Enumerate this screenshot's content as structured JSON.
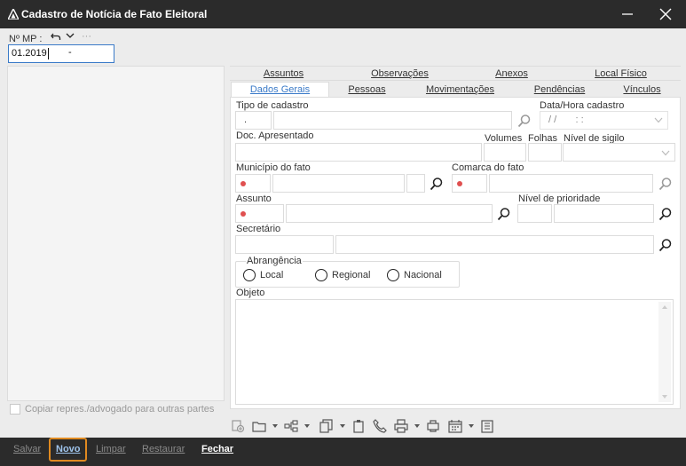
{
  "window": {
    "title": "Cadastro de Notícia de Fato Eleitoral"
  },
  "header": {
    "mp_label": "Nº MP :",
    "mp_value": "01.2019",
    "mp_suffix": "-",
    "more": "···"
  },
  "tabs_row1": [
    "Assuntos",
    "Observações",
    "Anexos",
    "Local Físico"
  ],
  "tabs_row2": [
    "Dados Gerais",
    "Pessoas",
    "Movimentações",
    "Pendências",
    "Vínculos"
  ],
  "form": {
    "tipo_cadastro_label": "Tipo de cadastro",
    "tipo_cadastro_code": ".",
    "data_hora_label": "Data/Hora cadastro",
    "data_hora_value": "/ /       : :",
    "doc_apresentado_label": "Doc. Apresentado",
    "volumes_label": "Volumes",
    "folhas_label": "Folhas",
    "nivel_sigilo_label": "Nível de sigilo",
    "municipio_label": "Município do fato",
    "comarca_label": "Comarca do fato",
    "assunto_label": "Assunto",
    "prioridade_label": "Nível de prioridade",
    "secretario_label": "Secretário",
    "abrangencia_label": "Abrangência",
    "abrangencia_options": [
      "Local",
      "Regional",
      "Nacional"
    ],
    "objeto_label": "Objeto"
  },
  "left_panel": {
    "checkbox_label": "Copiar repres./advogado para outras partes"
  },
  "bottom": {
    "salvar": "Salvar",
    "novo": "Novo",
    "limpar": "Limpar",
    "restaurar": "Restaurar",
    "fechar": "Fechar"
  },
  "colors": {
    "titlebar": "#2b2b2b",
    "accent": "#3a7ac8",
    "required": "#e05050",
    "highlight": "#e08a20"
  }
}
